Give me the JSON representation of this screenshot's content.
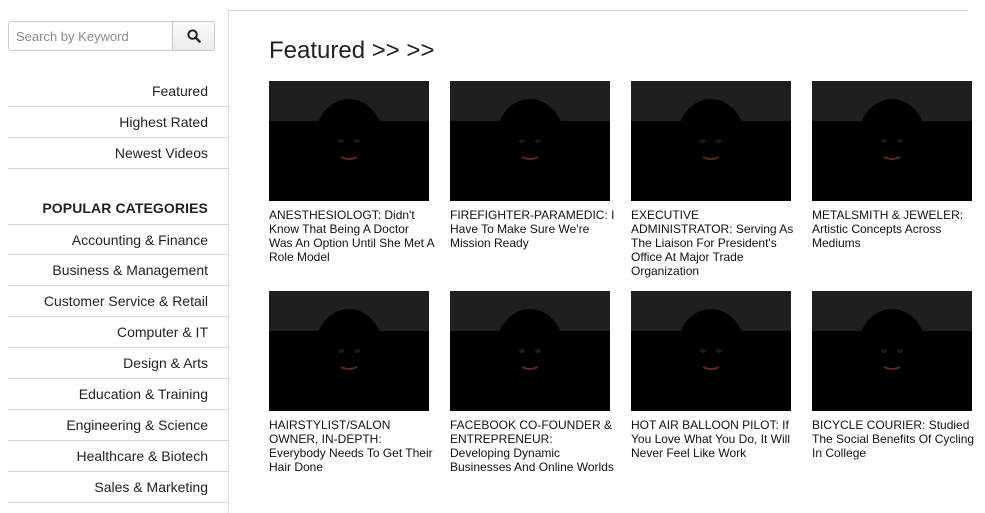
{
  "search": {
    "placeholder": "Search by Keyword",
    "icon": "search-icon"
  },
  "nav": [
    {
      "label": "Featured"
    },
    {
      "label": "Highest Rated"
    },
    {
      "label": "Newest Videos"
    }
  ],
  "categories": {
    "heading": "POPULAR CATEGORIES",
    "items": [
      {
        "label": "Accounting & Finance"
      },
      {
        "label": "Business & Management"
      },
      {
        "label": "Customer Service & Retail"
      },
      {
        "label": "Computer & IT"
      },
      {
        "label": "Design & Arts"
      },
      {
        "label": "Education & Training"
      },
      {
        "label": "Engineering & Science"
      },
      {
        "label": "Healthcare & Biotech"
      },
      {
        "label": "Sales & Marketing"
      }
    ]
  },
  "featured": {
    "title": "Featured >> >>",
    "videos": [
      {
        "caption": "ANESTHESIOLOGT: Didn't Know That Being A Doctor Was An Option Until She Met A Role Model",
        "bg": "#d9d2c6",
        "skin": "#6b4a3a",
        "shirt": "#1c1c1c",
        "hair": "#2a1a14",
        "hat": "#6e625a"
      },
      {
        "caption": "FIREFIGHTER-PARAMEDIC: I Have To Make Sure We're Mission Ready",
        "bg": "#b9c0c3",
        "skin": "#c79a82",
        "shirt": "#1e2a44",
        "hair": "#3a2a22",
        "hat": "#2b3a5c"
      },
      {
        "caption": "EXECUTIVE ADMINISTRATOR: Serving As The Liaison For President's Office At Major Trade Organization",
        "bg": "#c86a46",
        "skin": "#3b241c",
        "shirt": "#e03c8a",
        "hair": "#141010",
        "hat": ""
      },
      {
        "caption": "METALSMITH & JEWELER: Artistic Concepts Across Mediums",
        "bg": "#9a8a6a",
        "skin": "#d8a78c",
        "shirt": "#4a4a5c",
        "hair": "#7a4a2a",
        "hat": ""
      },
      {
        "caption": "HAIRSTYLIST/SALON OWNER, IN-DEPTH: Everybody Needs To Get Their Hair Done",
        "bg": "#6a4a3a",
        "skin": "#e2b49c",
        "shirt": "#8a6a5a",
        "hair": "#3a2418",
        "hat": ""
      },
      {
        "caption": "FACEBOOK CO-FOUNDER & ENTREPRENEUR: Developing Dynamic Businesses And Online Worlds",
        "bg": "#f2f2f2",
        "skin": "#c4987e",
        "shirt": "#222222",
        "hair": "#1e1612",
        "hat": ""
      },
      {
        "caption": "HOT AIR BALLOON PILOT: If You Love What You Do, It Will Never Feel Like Work",
        "bg": "#8a7a6a",
        "skin": "#c98c70",
        "shirt": "#4a5c3a",
        "hair": "#a08a6a",
        "hat": ""
      },
      {
        "caption": "BICYCLE COURIER: Studied The Social Benefits Of Cycling In College",
        "bg": "#e2c64a",
        "skin": "#c8987a",
        "shirt": "#8a8a8a",
        "hair": "#4a3a2a",
        "hat": "#3a4a5a"
      }
    ]
  }
}
